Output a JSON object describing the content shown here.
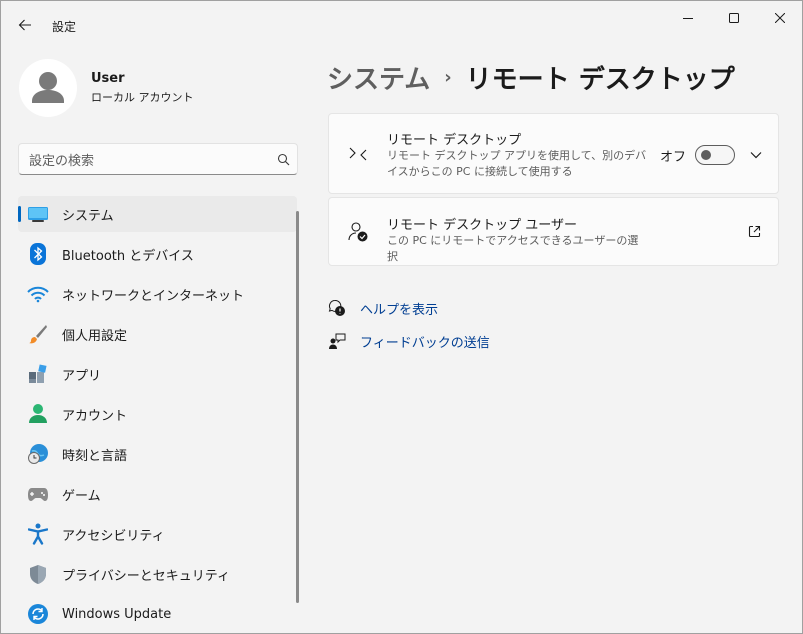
{
  "window": {
    "title": "設定"
  },
  "profile": {
    "name": "User",
    "account_type": "ローカル アカウント"
  },
  "search": {
    "placeholder": "設定の検索"
  },
  "sidebar": {
    "items": [
      {
        "label": "システム",
        "icon": "system-icon",
        "active": true
      },
      {
        "label": "Bluetooth とデバイス",
        "icon": "bluetooth-icon"
      },
      {
        "label": "ネットワークとインターネット",
        "icon": "wifi-icon"
      },
      {
        "label": "個人用設定",
        "icon": "brush-icon"
      },
      {
        "label": "アプリ",
        "icon": "apps-icon"
      },
      {
        "label": "アカウント",
        "icon": "account-icon"
      },
      {
        "label": "時刻と言語",
        "icon": "globe-clock-icon"
      },
      {
        "label": "ゲーム",
        "icon": "gamepad-icon"
      },
      {
        "label": "アクセシビリティ",
        "icon": "accessibility-icon"
      },
      {
        "label": "プライバシーとセキュリティ",
        "icon": "shield-icon"
      },
      {
        "label": "Windows Update",
        "icon": "update-icon"
      }
    ]
  },
  "breadcrumb": {
    "parent": "システム",
    "separator": "›",
    "current": "リモート デスクトップ"
  },
  "remote_desktop_card": {
    "title": "リモート デスクトップ",
    "description": "リモート デスクトップ アプリを使用して、別のデバイスからこの PC に接続して使用する",
    "toggle_label": "オフ",
    "toggle_on": false
  },
  "remote_users_card": {
    "title": "リモート デスクトップ ユーザー",
    "description": "この PC にリモートでアクセスできるユーザーの選択"
  },
  "links": {
    "help": "ヘルプを表示",
    "feedback": "フィードバックの送信"
  },
  "colors": {
    "accent": "#0067c0",
    "link": "#003e92",
    "background": "#f3f3f3"
  }
}
